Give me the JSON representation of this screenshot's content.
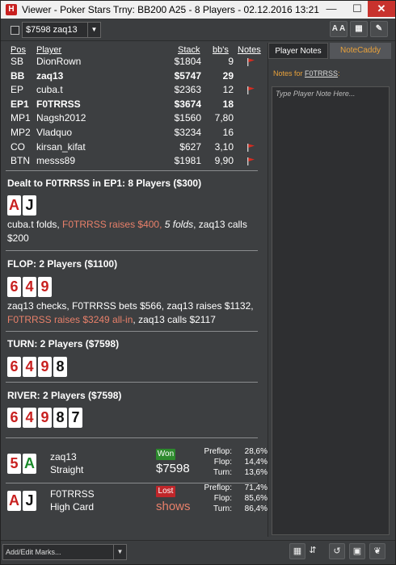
{
  "window": {
    "title": "Viewer - Poker Stars Trny: BB200 A25 - 8 Players - 02.12.2016 13:21",
    "app_icon": "H",
    "min_icon": "minimize-icon",
    "max_icon": "maximize-icon",
    "close_icon": "close-icon"
  },
  "toolbar": {
    "hand_select_value": "$7598 zaq13",
    "font_button_label": "A A"
  },
  "table": {
    "headers": {
      "pos": "Pos",
      "player": "Player",
      "stack": "Stack",
      "bbs": "bb's",
      "notes": "Notes"
    },
    "rows": [
      {
        "pos": "SB",
        "player": "DionRown",
        "stack": "$1804",
        "bbs": "9",
        "bold": false,
        "flag": true
      },
      {
        "pos": "BB",
        "player": "zaq13",
        "stack": "$5747",
        "bbs": "29",
        "bold": true,
        "flag": false
      },
      {
        "pos": "EP",
        "player": "cuba.t",
        "stack": "$2363",
        "bbs": "12",
        "bold": false,
        "flag": true
      },
      {
        "pos": "EP1",
        "player": "F0TRRSS",
        "stack": "$3674",
        "bbs": "18",
        "bold": true,
        "flag": false
      },
      {
        "pos": "MP1",
        "player": "Nagsh2012",
        "stack": "$1560",
        "bbs": "7,80",
        "bold": false,
        "flag": false
      },
      {
        "pos": "MP2",
        "player": "Vladquo",
        "stack": "$3234",
        "bbs": "16",
        "bold": false,
        "flag": false
      },
      {
        "pos": "CO",
        "player": "kirsan_kifat",
        "stack": "$627",
        "bbs": "3,10",
        "bold": false,
        "flag": true
      },
      {
        "pos": "BTN",
        "player": "messs89",
        "stack": "$1981",
        "bbs": "9,90",
        "bold": false,
        "flag": true
      }
    ]
  },
  "preflop": {
    "title": "Dealt to F0TRRSS in EP1: 8 Players ($300)",
    "cards": [
      {
        "rank": "A",
        "color": "red"
      },
      {
        "rank": "J",
        "color": "black"
      }
    ],
    "actions_a": "cuba.t folds, ",
    "actions_b": "F0TRRSS raises $400, ",
    "actions_c": "5 folds",
    "actions_d": ", zaq13 calls $200"
  },
  "flop": {
    "title": "FLOP: 2 Players ($1100)",
    "cards": [
      {
        "rank": "6",
        "color": "red"
      },
      {
        "rank": "4",
        "color": "red"
      },
      {
        "rank": "9",
        "color": "red"
      }
    ],
    "actions_a": "zaq13 checks, F0TRRSS bets $566, zaq13 raises $1132, ",
    "actions_b": "F0TRRSS raises $3249 all-in",
    "actions_c": ", zaq13 calls $2117"
  },
  "turn": {
    "title": "TURN: 2 Players ($7598)",
    "cards": [
      {
        "rank": "6",
        "color": "red"
      },
      {
        "rank": "4",
        "color": "red"
      },
      {
        "rank": "9",
        "color": "red"
      },
      {
        "rank": "8",
        "color": "black"
      }
    ]
  },
  "river": {
    "title": "RIVER: 2 Players ($7598)",
    "cards": [
      {
        "rank": "6",
        "color": "red"
      },
      {
        "rank": "4",
        "color": "red"
      },
      {
        "rank": "9",
        "color": "red"
      },
      {
        "rank": "8",
        "color": "black"
      },
      {
        "rank": "7",
        "color": "black"
      }
    ]
  },
  "results": [
    {
      "cards": [
        {
          "rank": "5",
          "color": "red"
        },
        {
          "rank": "A",
          "color": "green"
        }
      ],
      "player": "zaq13",
      "hand": "Straight",
      "badge": "Won",
      "amount": "$7598",
      "stats": [
        {
          "label": "Preflop:",
          "value": "28,6%"
        },
        {
          "label": "Flop:",
          "value": "14,4%"
        },
        {
          "label": "Turn:",
          "value": "13,6%"
        }
      ]
    },
    {
      "cards": [
        {
          "rank": "A",
          "color": "red"
        },
        {
          "rank": "J",
          "color": "black"
        }
      ],
      "player": "F0TRRSS",
      "hand": "High Card",
      "badge": "Lost",
      "amount": "shows",
      "stats": [
        {
          "label": "Preflop:",
          "value": "71,4%"
        },
        {
          "label": "Flop:",
          "value": "85,6%"
        },
        {
          "label": "Turn:",
          "value": "86,4%"
        }
      ]
    }
  ],
  "notes_panel": {
    "tab_notes": "Player Notes",
    "tab_caddy": "NoteCaddy",
    "notes_for_label": "Notes for ",
    "notes_for_player": "F0TRRSS",
    "notes_for_suffix": ":",
    "placeholder": "Type Player Note Here..."
  },
  "bottom": {
    "marks_select": "Add/Edit Marks...",
    "icons": [
      "calendar-icon",
      "sort-icon",
      "refresh-icon",
      "save-icon",
      "twitter-icon"
    ]
  },
  "colors": {
    "background": "#3d3f41",
    "highlight": "#e8806a",
    "accent": "#e9a23b",
    "won": "#2d8a2d",
    "lost": "#c0262a",
    "flag": "#d92b1f"
  }
}
